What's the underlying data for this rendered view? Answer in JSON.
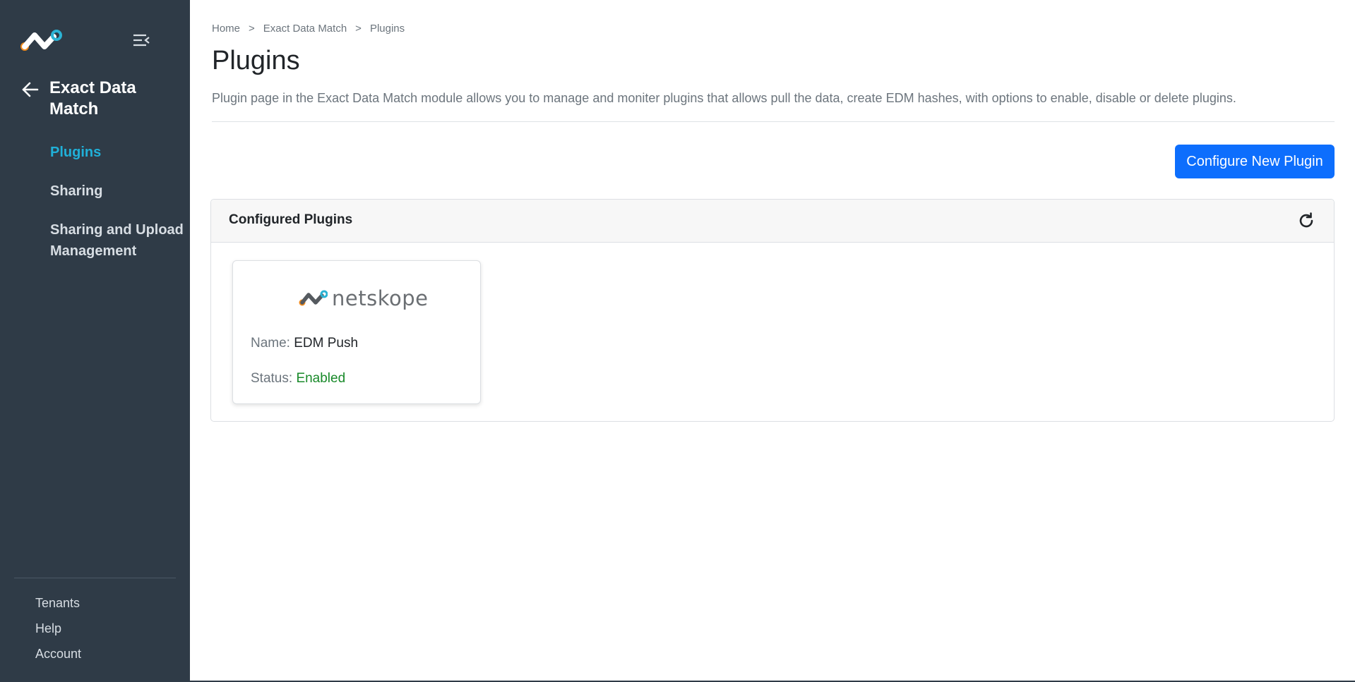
{
  "sidebar": {
    "module_title": "Exact Data Match",
    "nav_items": [
      {
        "label": "Plugins",
        "active": true
      },
      {
        "label": "Sharing",
        "active": false
      },
      {
        "label": "Sharing and Upload Management",
        "active": false
      }
    ],
    "bottom_items": [
      {
        "label": "Tenants"
      },
      {
        "label": "Help"
      },
      {
        "label": "Account"
      }
    ],
    "icons": {
      "logo": "netskope-logo-icon",
      "collapse": "menu-collapse-icon",
      "back": "arrow-left-icon"
    }
  },
  "breadcrumb": {
    "items": [
      "Home",
      "Exact Data Match",
      "Plugins"
    ],
    "separator": ">"
  },
  "main": {
    "title": "Plugins",
    "description": "Plugin page in the Exact Data Match module allows you to manage and moniter plugins that allows pull the data, create EDM hashes, with options to enable, disable or delete plugins.",
    "configure_button": "Configure New Plugin"
  },
  "panel": {
    "title": "Configured Plugins",
    "refresh_icon": "refresh-icon",
    "plugins": [
      {
        "brand": "netskope",
        "name_label": "Name:",
        "name": "EDM Push",
        "status_label": "Status:",
        "status": "Enabled"
      }
    ]
  },
  "colors": {
    "sidebar_bg": "#2f3b47",
    "active_nav": "#20b0d8",
    "primary": "#0d6efd",
    "status_enabled": "#198a2a",
    "logo_orange": "#f28c1e",
    "logo_teal": "#2bb3d4"
  }
}
